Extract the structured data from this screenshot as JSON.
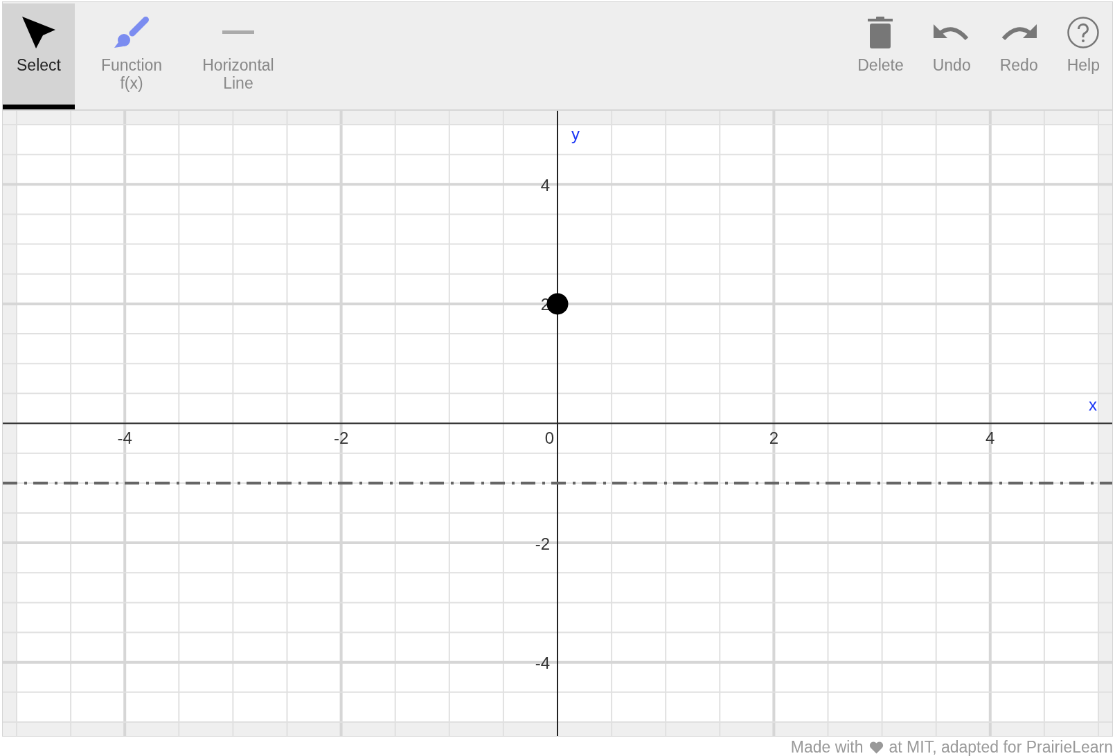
{
  "toolbar": {
    "tools": [
      {
        "kind": "select",
        "lines": [
          "Select"
        ],
        "selected": true
      },
      {
        "kind": "function",
        "lines": [
          "Function",
          "f(x)"
        ],
        "selected": false
      },
      {
        "kind": "horizontal-line",
        "lines": [
          "Horizontal",
          "Line"
        ],
        "selected": false
      }
    ],
    "actions": [
      {
        "kind": "delete",
        "label": "Delete"
      },
      {
        "kind": "undo",
        "label": "Undo"
      },
      {
        "kind": "redo",
        "label": "Redo"
      },
      {
        "kind": "help",
        "label": "Help"
      }
    ]
  },
  "canvas": {
    "chart_data": {
      "type": "scatter",
      "xlabel": "x",
      "ylabel": "y",
      "x": [
        0
      ],
      "series": [
        {
          "color": "#000000",
          "values": [
            2
          ]
        }
      ],
      "xlim": [
        -5,
        5
      ],
      "ylim": [
        -5,
        5
      ],
      "xticks": [
        -4,
        -2,
        0,
        2,
        4
      ],
      "yticks": [
        -4,
        -2,
        2,
        4
      ],
      "grid": true,
      "ref_lines": [
        {
          "axis": "y",
          "value": -1,
          "color": "#666666"
        }
      ]
    }
  },
  "footer": {
    "text_before": "Made with",
    "text_after": "at MIT, adapted for PrairieLearn"
  }
}
